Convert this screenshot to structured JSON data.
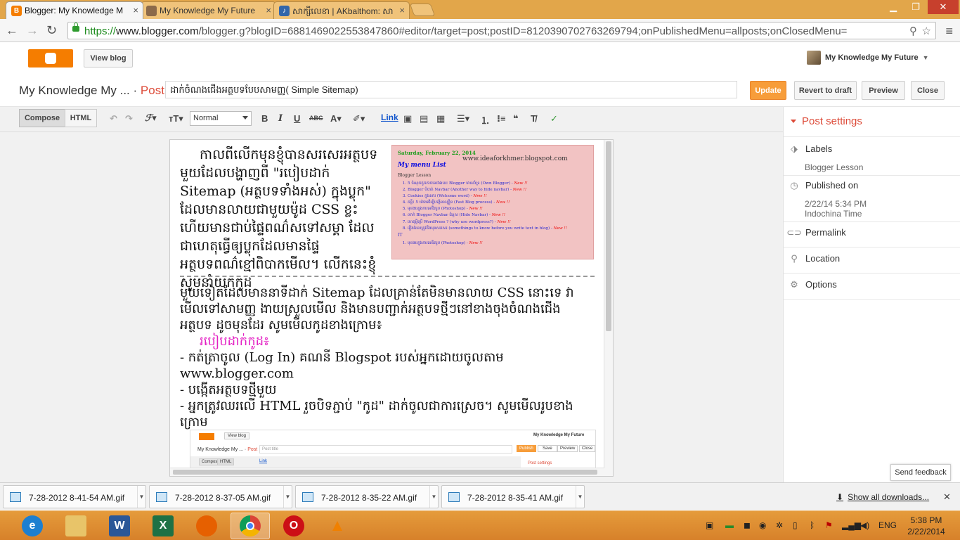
{
  "browser": {
    "tabs": [
      {
        "title": "Blogger: My Knowledge M",
        "active": true
      },
      {
        "title": "My Knowledge My Future",
        "active": false
      },
      {
        "title": "សាក្សីលេខា | AKbalthom: សា",
        "active": false
      }
    ],
    "url_scheme": "https://",
    "url_host": "www.blogger.com",
    "url_rest": "/blogger.g?blogID=6881469022553847860#editor/target=post;postID=8120390702763269794;onPublishedMenu=allposts;onClosedMenu="
  },
  "header": {
    "view_blog": "View blog",
    "user_name": "My Knowledge My Future"
  },
  "titlebar": {
    "blog_name": "My Knowledge My ...",
    "separator": "·",
    "post_label": "Post",
    "post_title": "ដាក់ចំណងជើងអត្ថបទបែបសាមញ្ញ( Simple Sitemap)",
    "update": "Update",
    "revert": "Revert to draft",
    "preview": "Preview",
    "close": "Close"
  },
  "toolbar": {
    "compose": "Compose",
    "html": "HTML",
    "format": "Normal",
    "link": "Link"
  },
  "editor": {
    "para1": "កាលពីលើកមុនខ្ញុំបានសរសេរអត្ថបទមួយដែលបង្ហាញពី \"របៀបដាក់ Sitemap (អត្ថបទទាំងអស់) ក្នុងប្លុក\" ដែលមានលាយជាមួយម៉ូដ CSS ខ្លះ ហើយមានជាប់ផ្ទៃពណ៌សទៅសម្គា ដែលជាហេតុធ្វើឲ្យប្លុកដែលមានផ្ទៃអត្ថបទពណ៌ខ្មៅពិបាកមើល។ លើកនេះខ្ញុំសូមនាំយកកូដ",
    "para2": "មួយទៀតដែលមាននាទីដាក់ Sitemap ដែលគ្រាន់តែមិនមានលាយ CSS នោះទេ វាមើលទៅសាមញ្ញ ងាយស្រួលមើល និងមានបញ្ជាក់អត្ថបទថ្មីៗនៅខាងចុងចំណងជើងអត្ថបទ ដូចមុនដែរ សូមមើលកូដខាងក្រោម៖",
    "how_to": "របៀបដាក់កូដ៖",
    "step1": "- កត់ត្រាចូល (Log In) គណនី Blogspot របស់អ្នកដោយចូលតាម www.blogger.com",
    "step2": "- បង្កើតអត្ថបទថ្មីមួយ",
    "step3": "- អ្នកត្រូវឈរលើ HTML រួចបិទភ្ជាប់ \"កូដ\" ដាក់ចូលជាការស្រេច។ សូមមើលរូបខាងក្រោម",
    "sitemap_image": {
      "date": "Saturday, February 22, 2014",
      "site": "www.ideaforkhmer.blogspot.com",
      "title": "My menu List",
      "label": "Blogger Lesson",
      "items": [
        "5 ចំណុចតូចតាចទេជាងនេះ Blogger មានគាំទ្រ (Own Blogger) -",
        "Blogger បំបាត់ Navbar (Another way to hide navbar) -",
        "Cookies ក្នុងសារ (Welcome word) -",
        "គន្លឹះ 5 យ៉ាងជើម្បីបង្កើនល្បឿន (Fast Blog process) -",
        "មុខងារក្នុងការអេឌីតរូប (Photoshop) -",
        "លាក់ Blogger Navbar ជំនួស (Hide Navbar) -",
        "ហេតុអ្វីប្រើ WordPress ? (why use wordpress?) -",
        "រឿងដែលត្រូវដឹងមុនសរសេរ (somethings to know before you write text in blog) -"
      ],
      "new_label": "New !!",
      "it_label": "IT",
      "it_item": "មុខងារក្នុងការអេឌីតរូប (Photoshop) -"
    },
    "mini": {
      "view_blog": "View blog",
      "user": "My Knowledge My Future",
      "blog_name": "My Knowledge My ...",
      "post_label": "Post",
      "title_ph": "Post title",
      "publish": "Publish",
      "save": "Save",
      "preview": "Preview",
      "close": "Close",
      "compose": "Compose",
      "html": "HTML",
      "link": "Link",
      "settings": "Post settings"
    }
  },
  "sidebar": {
    "heading": "Post settings",
    "labels": "Labels",
    "labels_value": "Blogger Lesson",
    "published_on": "Published on",
    "published_date": "2/22/14 5:34 PM",
    "published_tz": "Indochina Time",
    "permalink": "Permalink",
    "location": "Location",
    "options": "Options"
  },
  "feedback": "Send feedback",
  "downloads": {
    "items": [
      "7-28-2012 8-41-54 AM.gif",
      "7-28-2012 8-37-05 AM.gif",
      "7-28-2012 8-35-22 AM.gif",
      "7-28-2012 8-35-41 AM.gif"
    ],
    "show_all": "Show all downloads..."
  },
  "taskbar": {
    "lang": "ENG",
    "time": "5:38 PM",
    "date": "2/22/2014"
  },
  "colors": {
    "blogger_orange": "#f57d00",
    "update_btn": "#f79d3a",
    "accent_red": "#dd4b39",
    "taskbar": "#e59b3b"
  }
}
